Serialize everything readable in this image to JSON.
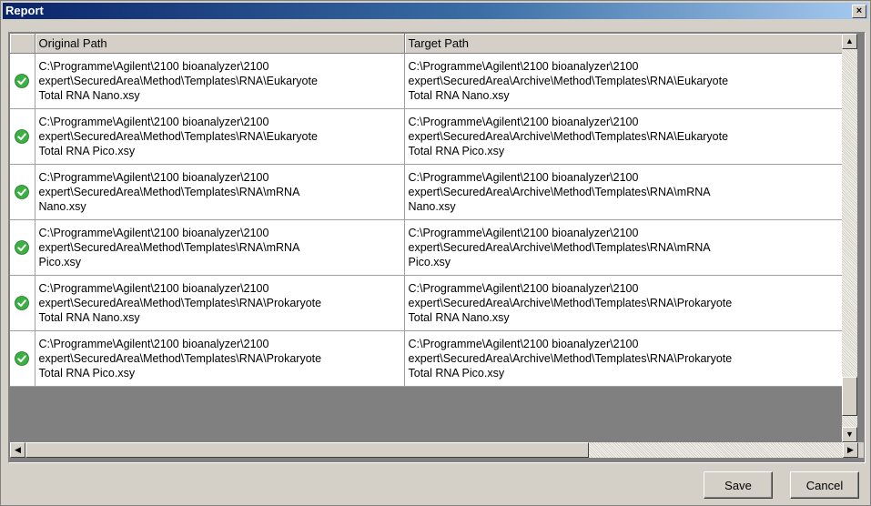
{
  "window": {
    "title": "Report",
    "close_symbol": "×"
  },
  "grid": {
    "columns": [
      "Original Path",
      "Target Path"
    ],
    "rows": [
      {
        "status": "check-icon",
        "original": "C:\\Programme\\Agilent\\2100 bioanalyzer\\2100\nexpert\\SecuredArea\\Method\\Templates\\RNA\\Eukaryote\nTotal RNA Nano.xsy",
        "target": "C:\\Programme\\Agilent\\2100 bioanalyzer\\2100\nexpert\\SecuredArea\\Archive\\Method\\Templates\\RNA\\Eukaryote\nTotal RNA Nano.xsy"
      },
      {
        "status": "check-icon",
        "original": "C:\\Programme\\Agilent\\2100 bioanalyzer\\2100\nexpert\\SecuredArea\\Method\\Templates\\RNA\\Eukaryote\nTotal RNA Pico.xsy",
        "target": "C:\\Programme\\Agilent\\2100 bioanalyzer\\2100\nexpert\\SecuredArea\\Archive\\Method\\Templates\\RNA\\Eukaryote\nTotal RNA Pico.xsy"
      },
      {
        "status": "check-icon",
        "original": "C:\\Programme\\Agilent\\2100 bioanalyzer\\2100\nexpert\\SecuredArea\\Method\\Templates\\RNA\\mRNA\nNano.xsy",
        "target": "C:\\Programme\\Agilent\\2100 bioanalyzer\\2100\nexpert\\SecuredArea\\Archive\\Method\\Templates\\RNA\\mRNA\nNano.xsy"
      },
      {
        "status": "check-icon",
        "original": "C:\\Programme\\Agilent\\2100 bioanalyzer\\2100\nexpert\\SecuredArea\\Method\\Templates\\RNA\\mRNA\nPico.xsy",
        "target": "C:\\Programme\\Agilent\\2100 bioanalyzer\\2100\nexpert\\SecuredArea\\Archive\\Method\\Templates\\RNA\\mRNA\nPico.xsy"
      },
      {
        "status": "check-icon",
        "original": "C:\\Programme\\Agilent\\2100 bioanalyzer\\2100\nexpert\\SecuredArea\\Method\\Templates\\RNA\\Prokaryote\nTotal RNA Nano.xsy",
        "target": "C:\\Programme\\Agilent\\2100 bioanalyzer\\2100\nexpert\\SecuredArea\\Archive\\Method\\Templates\\RNA\\Prokaryote\nTotal RNA Nano.xsy"
      },
      {
        "status": "check-icon",
        "original": "C:\\Programme\\Agilent\\2100 bioanalyzer\\2100\nexpert\\SecuredArea\\Method\\Templates\\RNA\\Prokaryote\nTotal RNA Pico.xsy",
        "target": "C:\\Programme\\Agilent\\2100 bioanalyzer\\2100\nexpert\\SecuredArea\\Archive\\Method\\Templates\\RNA\\Prokaryote\nTotal RNA Pico.xsy"
      }
    ]
  },
  "buttons": {
    "save": "Save",
    "cancel": "Cancel"
  },
  "colors": {
    "check": "#3cb043",
    "title_start": "#0a246a",
    "title_end": "#a6caf0"
  }
}
